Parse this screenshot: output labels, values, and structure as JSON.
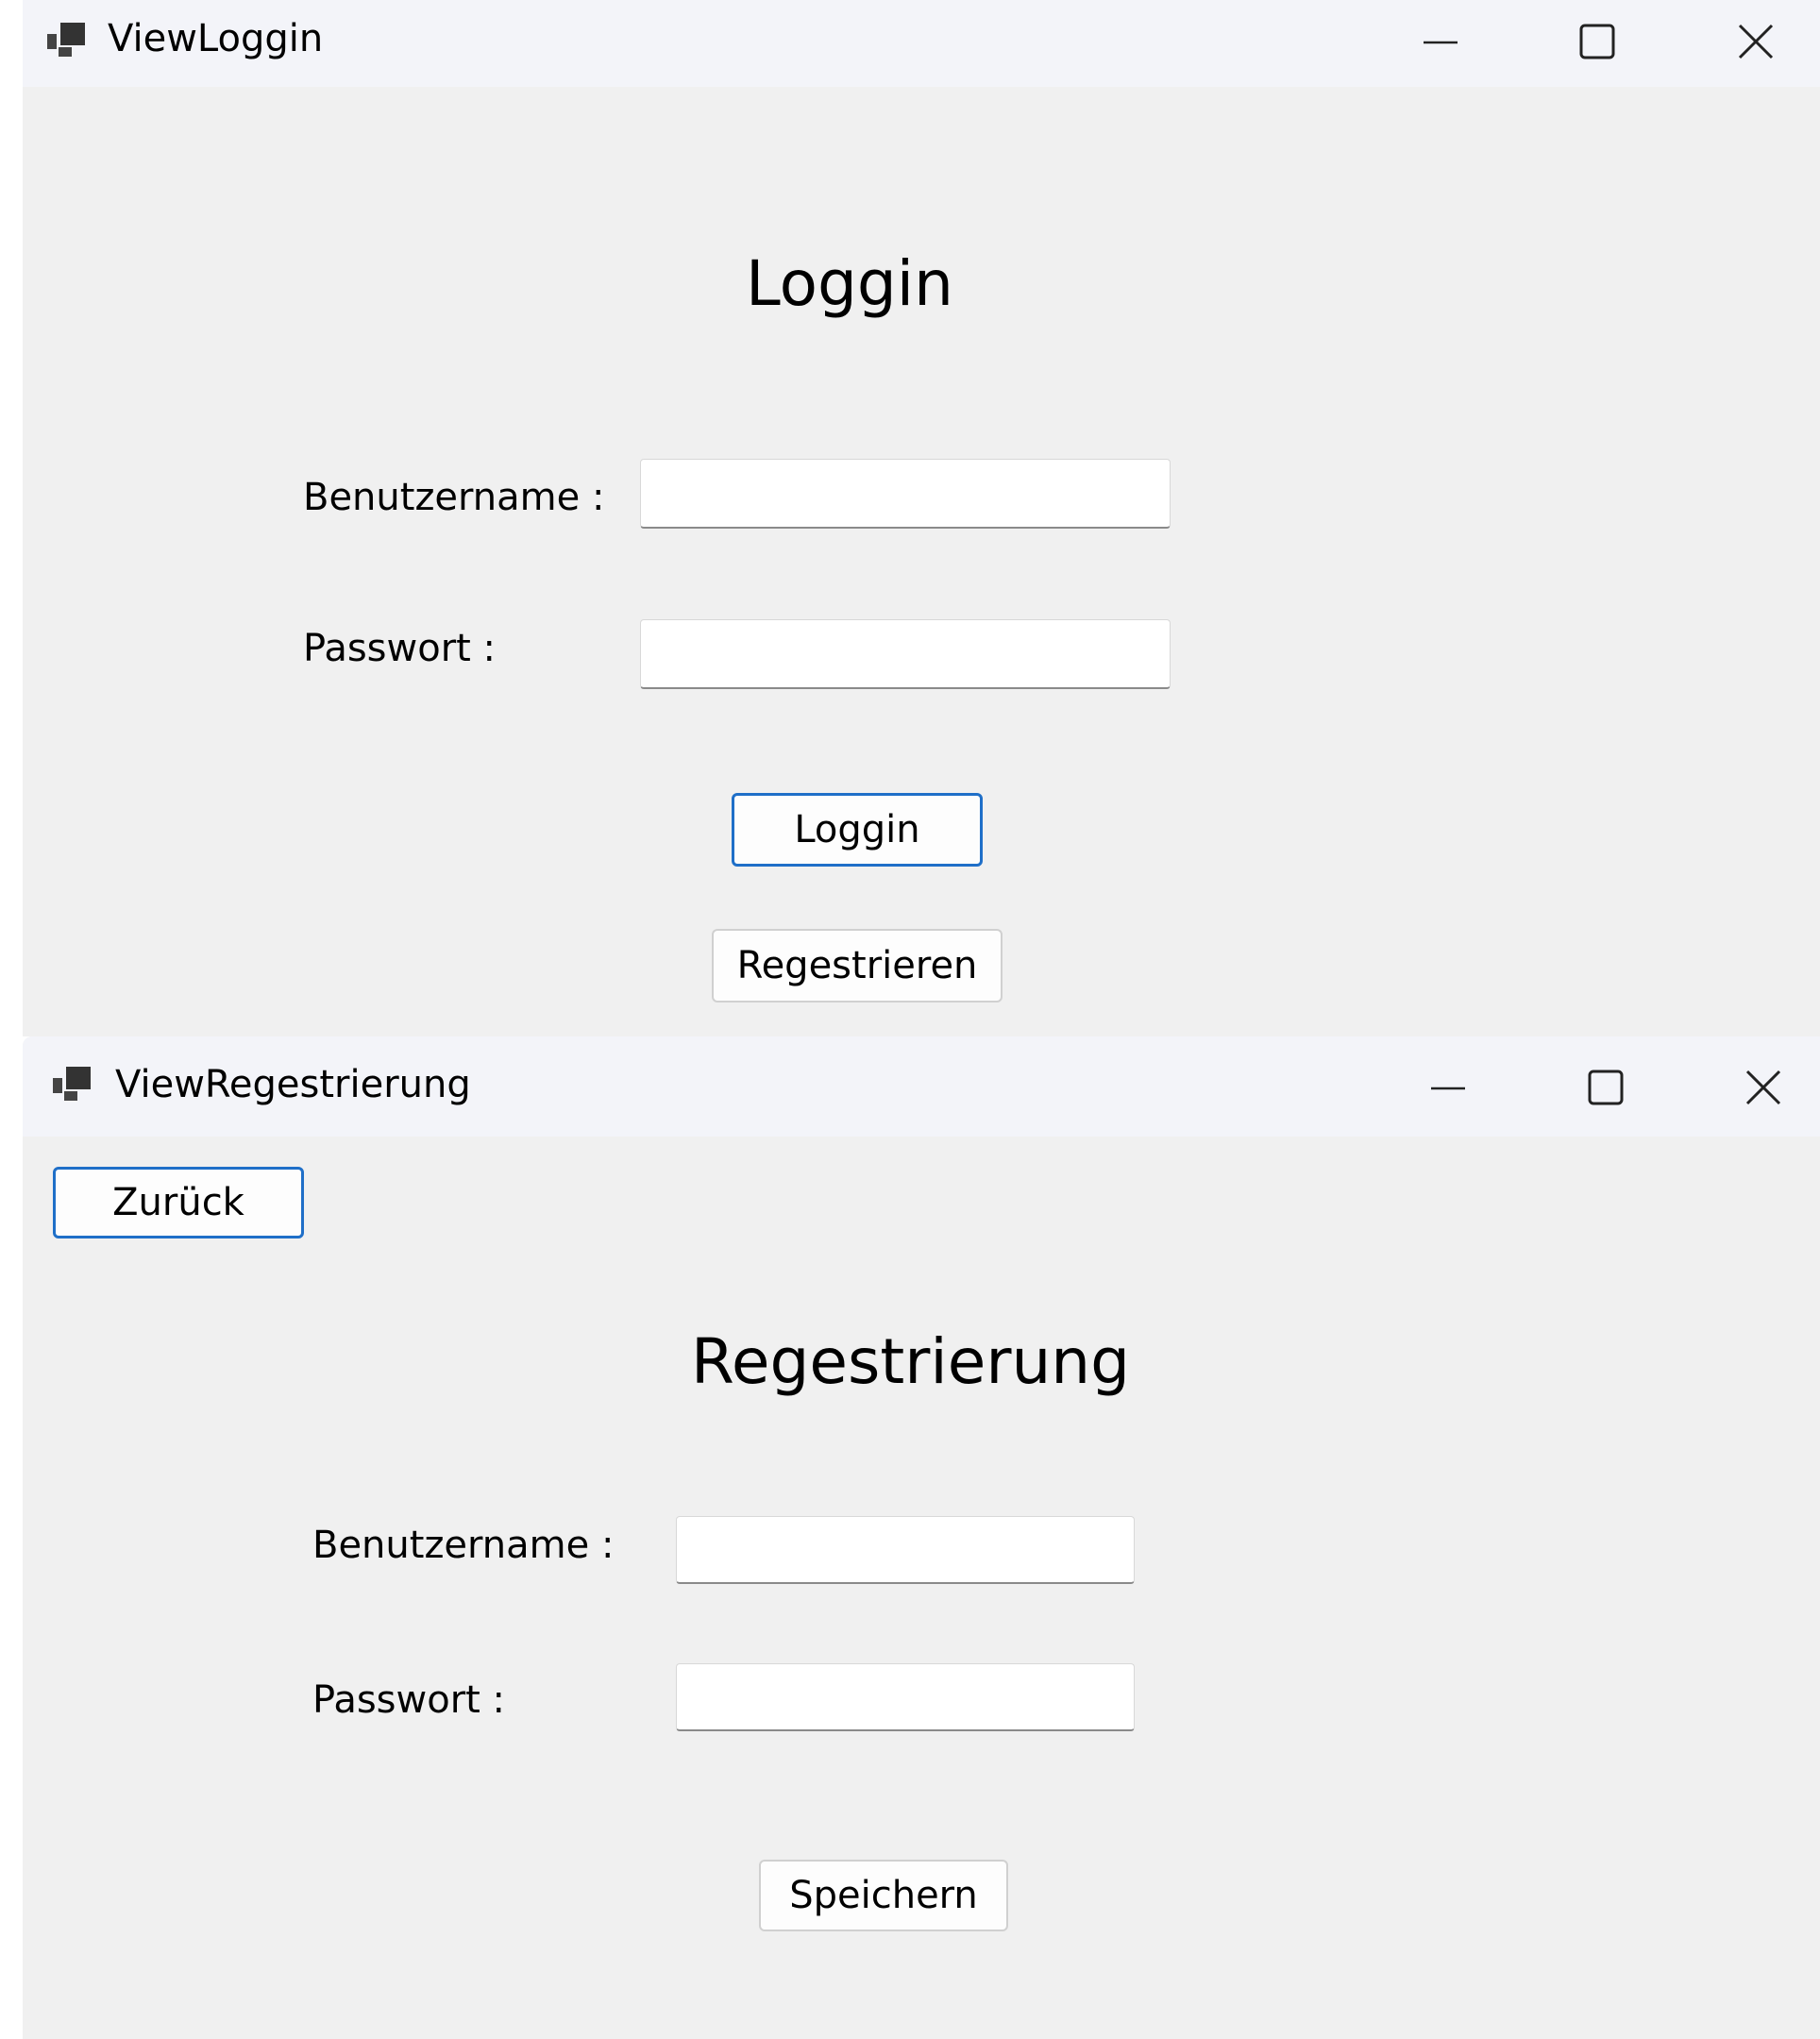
{
  "login_window": {
    "title": "ViewLoggin",
    "heading": "Loggin",
    "username_label": "Benutzername :",
    "username_value": "",
    "password_label": "Passwort :",
    "password_value": "",
    "login_button": "Loggin",
    "register_button": "Regestrieren"
  },
  "register_window": {
    "title": "ViewRegestrierung",
    "back_button": "Zurück",
    "heading": "Regestrierung",
    "username_label": "Benutzername :",
    "username_value": "",
    "password_label": "Passwort :",
    "password_value": "",
    "save_button": "Speichern"
  },
  "icons": {
    "app": "app-window-icon",
    "minimize": "minimize-icon",
    "maximize": "maximize-icon",
    "close": "close-icon"
  },
  "colors": {
    "window_bg": "#f0f0f0",
    "titlebar_bg": "#f3f4f9",
    "accent_border": "#1f6fc8"
  }
}
